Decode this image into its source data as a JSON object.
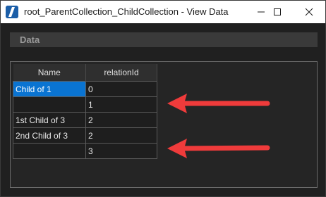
{
  "window": {
    "title": "root_ParentCollection_ChildCollection - View Data"
  },
  "panel": {
    "header_label": "Data"
  },
  "table": {
    "columns": [
      "Name",
      "relationId"
    ],
    "rows": [
      {
        "name": "Child of 1",
        "relationId": "0",
        "selected": true
      },
      {
        "name": "",
        "relationId": "1",
        "selected": false
      },
      {
        "name": "1st Child of 3",
        "relationId": "2",
        "selected": false
      },
      {
        "name": "2nd Child of 3",
        "relationId": "2",
        "selected": false
      },
      {
        "name": "",
        "relationId": "3",
        "selected": false
      }
    ]
  },
  "colors": {
    "accent_selection": "#0a74d2",
    "annotation_arrow": "#ef3b3b",
    "app_icon": "#1b5ea8"
  },
  "icons": {
    "app": "app-logo-icon",
    "minimize": "minimize-icon",
    "maximize": "maximize-icon",
    "close": "close-icon",
    "annotation": "red-arrow-icon"
  }
}
